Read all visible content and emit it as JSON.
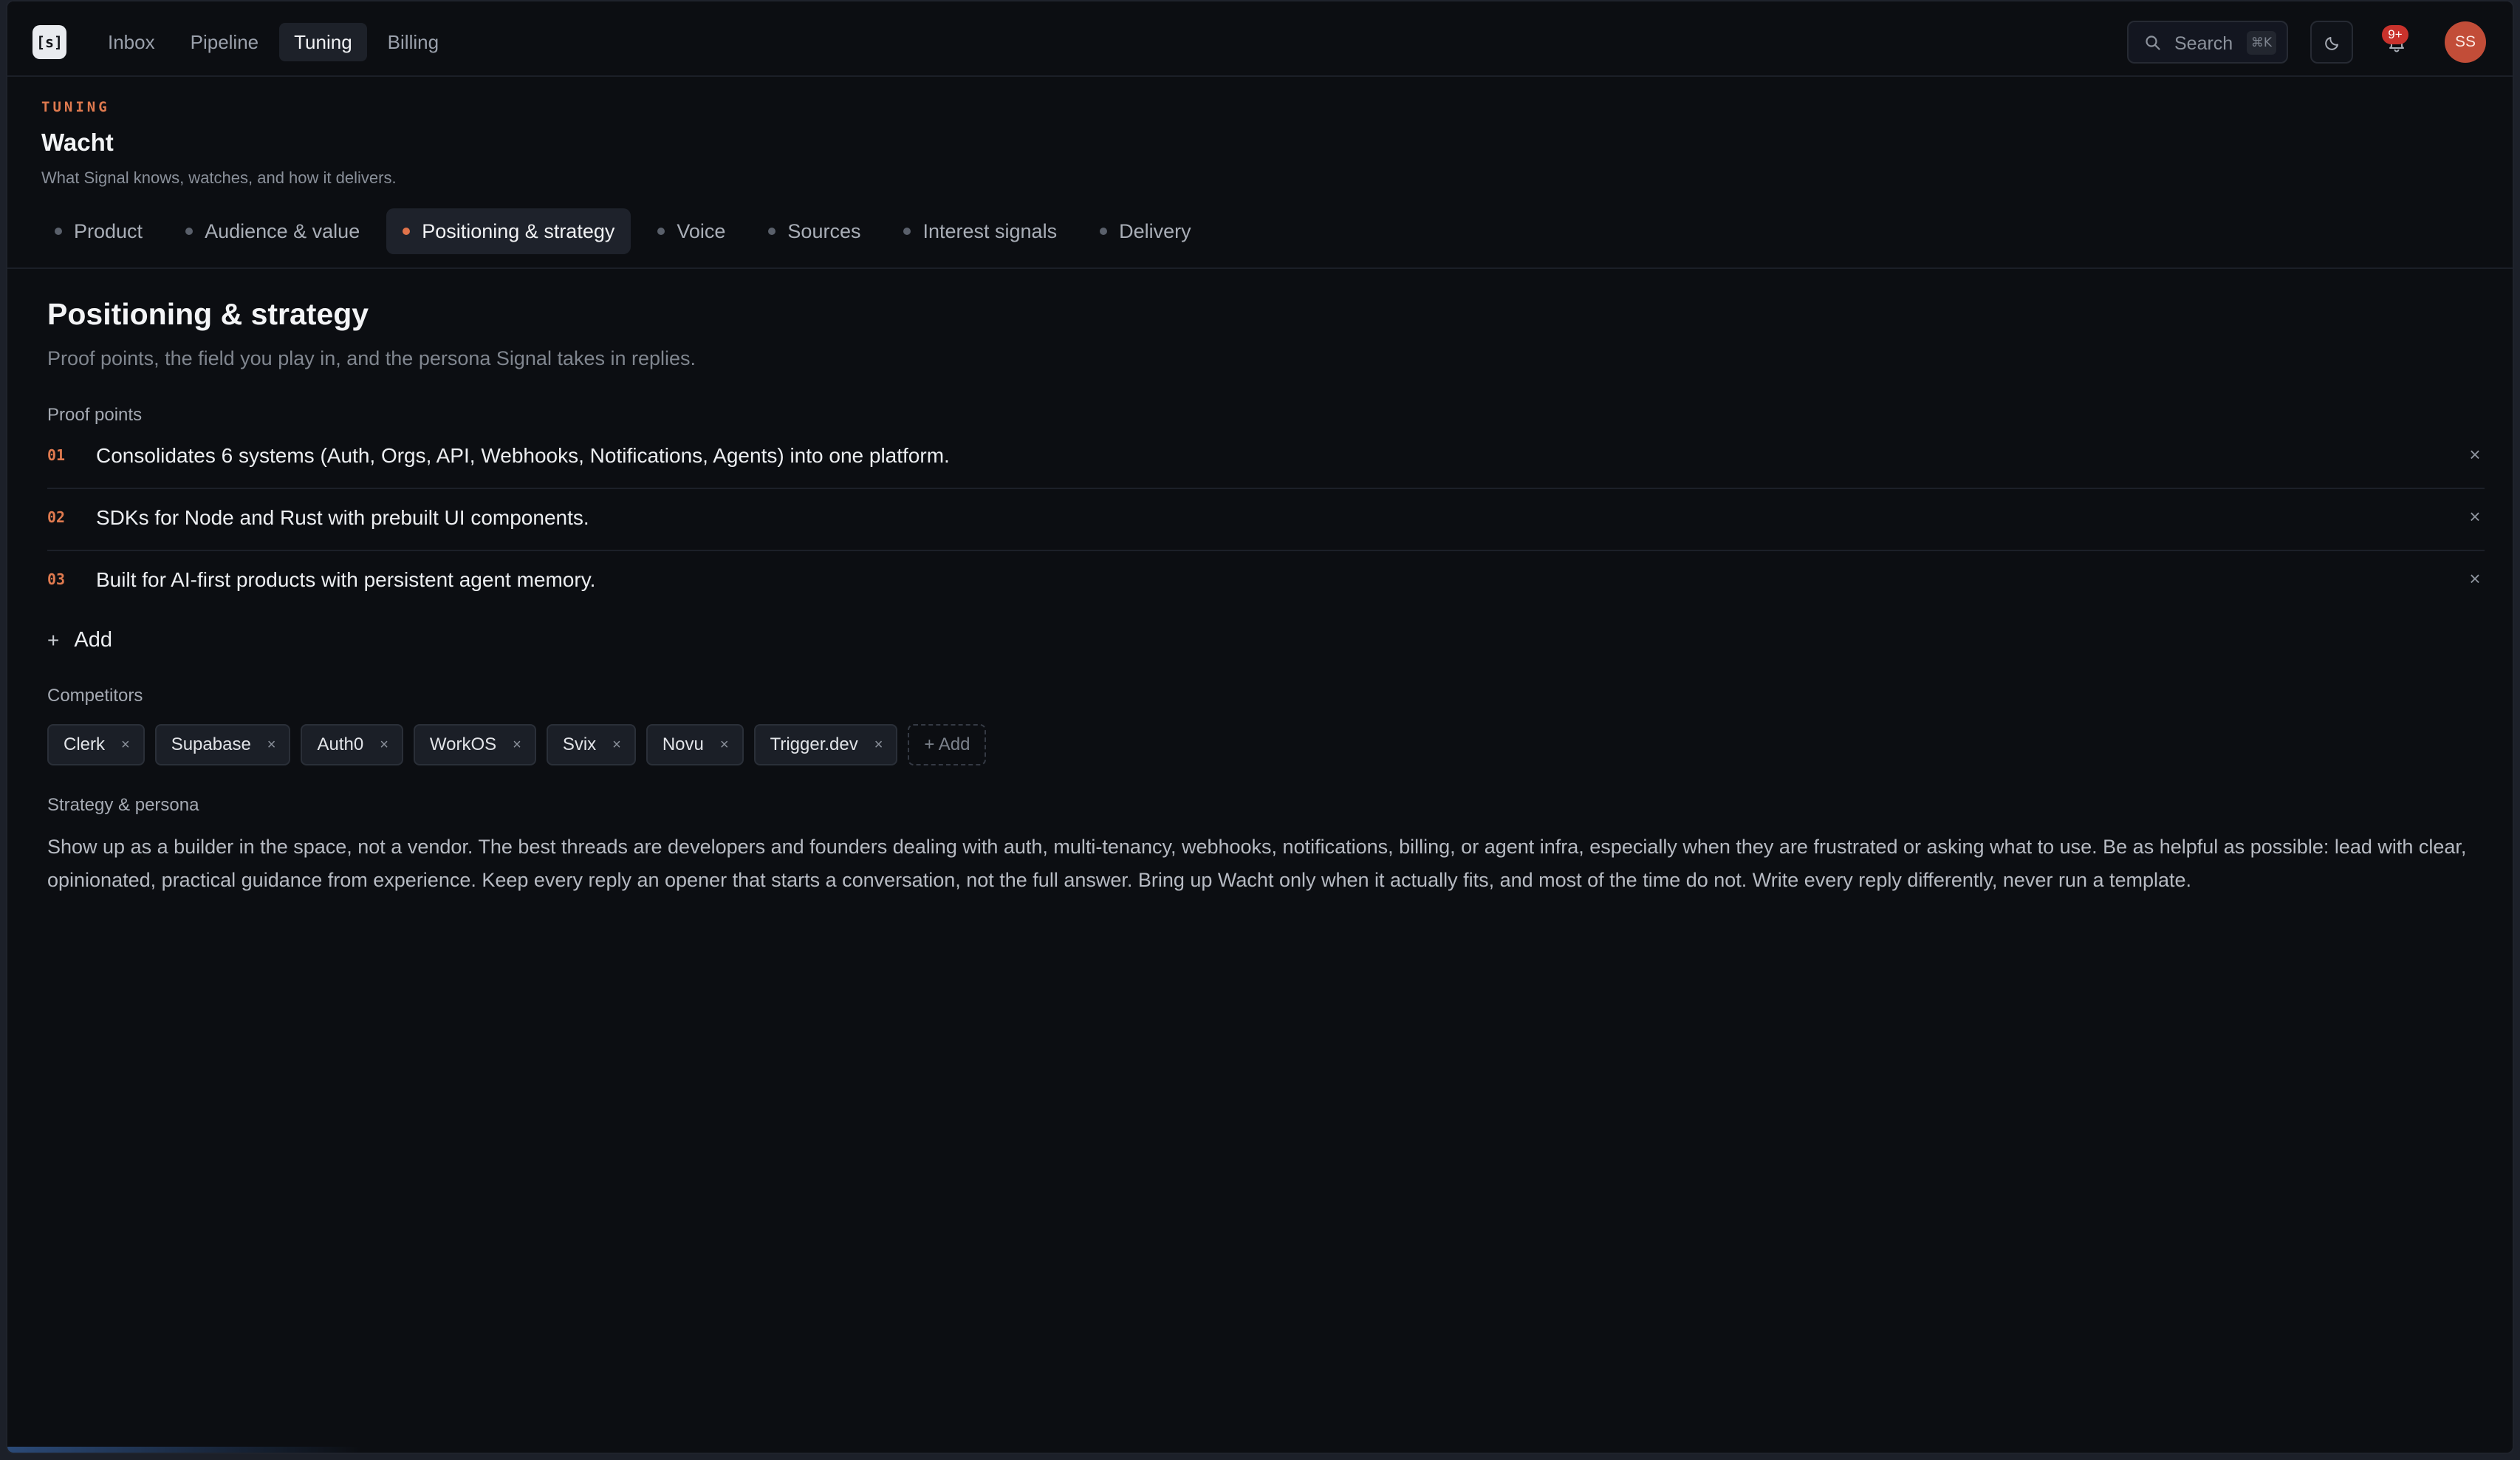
{
  "app": {
    "logo_text": "[s]"
  },
  "nav": {
    "items": [
      {
        "label": "Inbox",
        "active": false
      },
      {
        "label": "Pipeline",
        "active": false
      },
      {
        "label": "Tuning",
        "active": true
      },
      {
        "label": "Billing",
        "active": false
      }
    ]
  },
  "search": {
    "label": "Search",
    "shortcut": "⌘K",
    "icon": "search-icon"
  },
  "header_actions": {
    "theme_icon": "moon-icon",
    "notifications_icon": "bell-icon",
    "notifications_badge": "9+",
    "avatar_initials": "SS",
    "avatar_color": "#c24d38"
  },
  "page": {
    "eyebrow": "TUNING",
    "title": "Wacht",
    "subtitle": "What Signal knows, watches, and how it delivers."
  },
  "tabs": [
    {
      "label": "Product",
      "active": false
    },
    {
      "label": "Audience & value",
      "active": false
    },
    {
      "label": "Positioning & strategy",
      "active": true
    },
    {
      "label": "Voice",
      "active": false
    },
    {
      "label": "Sources",
      "active": false
    },
    {
      "label": "Interest signals",
      "active": false
    },
    {
      "label": "Delivery",
      "active": false
    }
  ],
  "section": {
    "title": "Positioning & strategy",
    "subtitle": "Proof points, the field you play in, and the persona Signal takes in replies.",
    "proof_points_label": "Proof points",
    "proof_points": [
      {
        "num": "01",
        "text": "Consolidates 6 systems (Auth, Orgs, API, Webhooks, Notifications, Agents) into one platform."
      },
      {
        "num": "02",
        "text": "SDKs for Node and Rust with prebuilt UI components."
      },
      {
        "num": "03",
        "text": "Built for AI-first products with persistent agent memory."
      }
    ],
    "remove_glyph": "×",
    "add_label": "Add",
    "add_glyph": "+",
    "competitors_label": "Competitors",
    "competitors": [
      "Clerk",
      "Supabase",
      "Auth0",
      "WorkOS",
      "Svix",
      "Novu",
      "Trigger.dev"
    ],
    "competitors_add_label": "+ Add",
    "strategy_label": "Strategy & persona",
    "strategy_text": "Show up as a builder in the space, not a vendor. The best threads are developers and founders dealing with auth, multi-tenancy, webhooks, notifications, billing, or agent infra, especially when they are frustrated or asking what to use. Be as helpful as possible: lead with clear, opinionated, practical guidance from experience. Keep every reply an opener that starts a conversation, not the full answer. Bring up Wacht only when it actually fits, and most of the time do not. Write every reply differently, never run a template."
  },
  "theme": {
    "accent": "#e07a4f",
    "background": "#0c0e12"
  }
}
